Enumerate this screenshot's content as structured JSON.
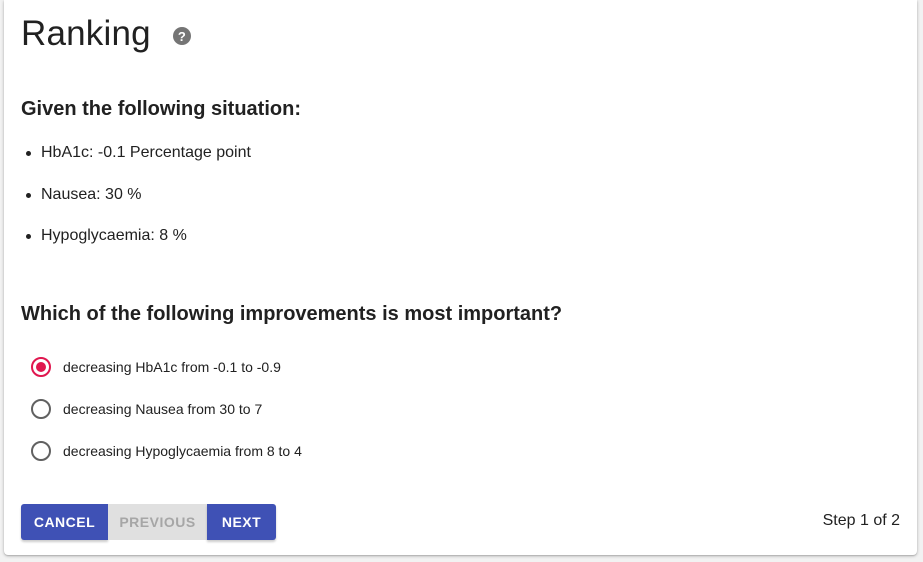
{
  "header": {
    "title": "Ranking",
    "help_icon": "help-circle-icon",
    "help_glyph": "?"
  },
  "situation": {
    "heading": "Given the following situation:",
    "items": [
      "HbA1c: -0.1 Percentage point",
      "Nausea: 30 %",
      "Hypoglycaemia: 8 %"
    ]
  },
  "question": {
    "heading": "Which of the following improvements is most important?",
    "options": [
      {
        "label": "decreasing HbA1c from -0.1 to -0.9",
        "selected": true
      },
      {
        "label": "decreasing Nausea from 30 to 7",
        "selected": false
      },
      {
        "label": "decreasing Hypoglycaemia from 8 to 4",
        "selected": false
      }
    ]
  },
  "actions": {
    "cancel_label": "CANCEL",
    "previous_label": "PREVIOUS",
    "next_label": "NEXT",
    "previous_disabled": true
  },
  "step_indicator": "Step 1 of 2",
  "colors": {
    "primary": "#3f51b5",
    "accent": "#e0174f",
    "disabled_bg": "#e0e0e0",
    "disabled_text": "#a6a6a6"
  }
}
